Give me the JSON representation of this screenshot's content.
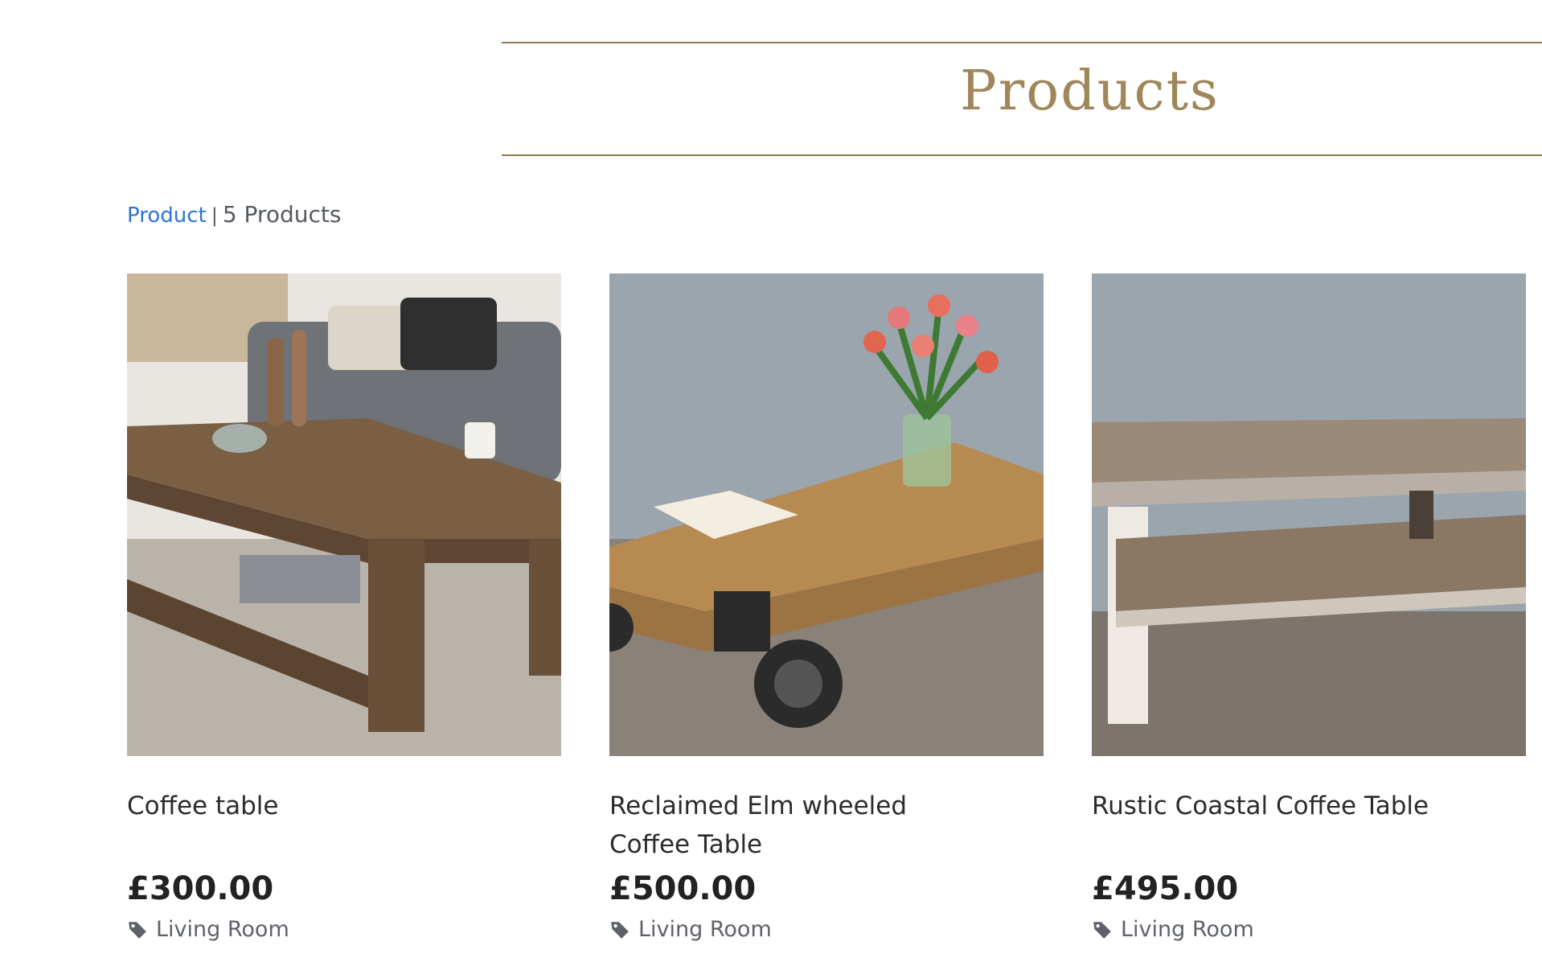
{
  "page": {
    "title": "Products"
  },
  "breadcrumb": {
    "link_label": "Product",
    "separator": "|",
    "count_label": "5 Products"
  },
  "products": [
    {
      "name": "Coffee table",
      "price": "£300.00",
      "category": "Living Room",
      "category_icon": "tag-icon",
      "image_subject": "rustic wooden coffee table in living room"
    },
    {
      "name": "Reclaimed Elm wheeled Coffee Table",
      "price": "£500.00",
      "category": "Living Room",
      "category_icon": "tag-icon",
      "image_subject": "elm coffee table on cast iron wheels with flowers and book"
    },
    {
      "name": "Rustic Coastal Coffee Table",
      "price": "£495.00",
      "category": "Living Room",
      "category_icon": "tag-icon",
      "image_subject": "distressed white and wood coffee table"
    }
  ],
  "colors": {
    "accent_gold": "#a0865a",
    "rule_line": "#8c7a4f",
    "link_blue": "#2f74d6",
    "text_dark": "#222222",
    "text_muted": "#5e6268"
  }
}
